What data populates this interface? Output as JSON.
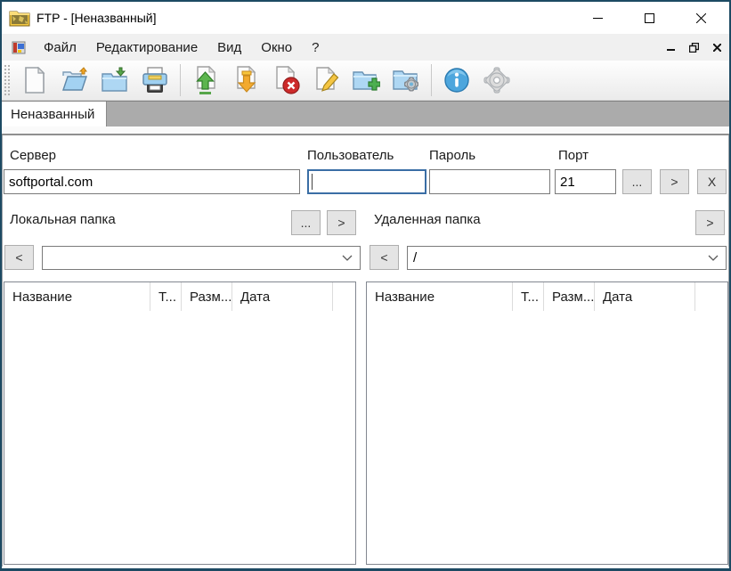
{
  "window": {
    "title": "FTP - [Неназванный]",
    "controls": [
      "minimize",
      "maximize",
      "close"
    ]
  },
  "menu": {
    "items": [
      {
        "label": "Файл"
      },
      {
        "label": "Редактирование"
      },
      {
        "label": "Вид"
      },
      {
        "label": "Окно"
      },
      {
        "label": "?"
      }
    ]
  },
  "toolbar": {
    "icons": [
      "new-document",
      "open-folder",
      "save-folder",
      "print",
      "upload-file",
      "download-file",
      "delete-file",
      "edit-file",
      "add-folder",
      "folder-settings",
      "info",
      "settings"
    ]
  },
  "tab": {
    "label": "Неназванный"
  },
  "form": {
    "server": {
      "label": "Сервер",
      "value": "softportal.com"
    },
    "user": {
      "label": "Пользователь",
      "value": ""
    },
    "password": {
      "label": "Пароль",
      "value": ""
    },
    "port": {
      "label": "Порт",
      "value": "21"
    },
    "browse_button": "...",
    "connect_button": ">",
    "disconnect_button": "X",
    "local": {
      "label": "Локальная папка",
      "browse": "...",
      "send": ">",
      "back": "<",
      "path": ""
    },
    "remote": {
      "label": "Удаленная папка",
      "send": ">",
      "back": "<",
      "path": "/"
    }
  },
  "lists": {
    "local": {
      "columns": [
        "Название",
        "Т...",
        "Разм...",
        "Дата"
      ],
      "rows": []
    },
    "remote": {
      "columns": [
        "Название",
        "Т...",
        "Разм...",
        "Дата"
      ],
      "rows": []
    }
  },
  "colors": {
    "window_border": "#1d4a63",
    "tabstrip": "#ababab",
    "focus_border": "#3a6ea5",
    "button_bg": "#e4e4e4",
    "info_blue": "#4da6dd",
    "upload_green": "#5cb54e",
    "download_orange": "#f3aa2e",
    "delete_red": "#cc2a2a"
  }
}
